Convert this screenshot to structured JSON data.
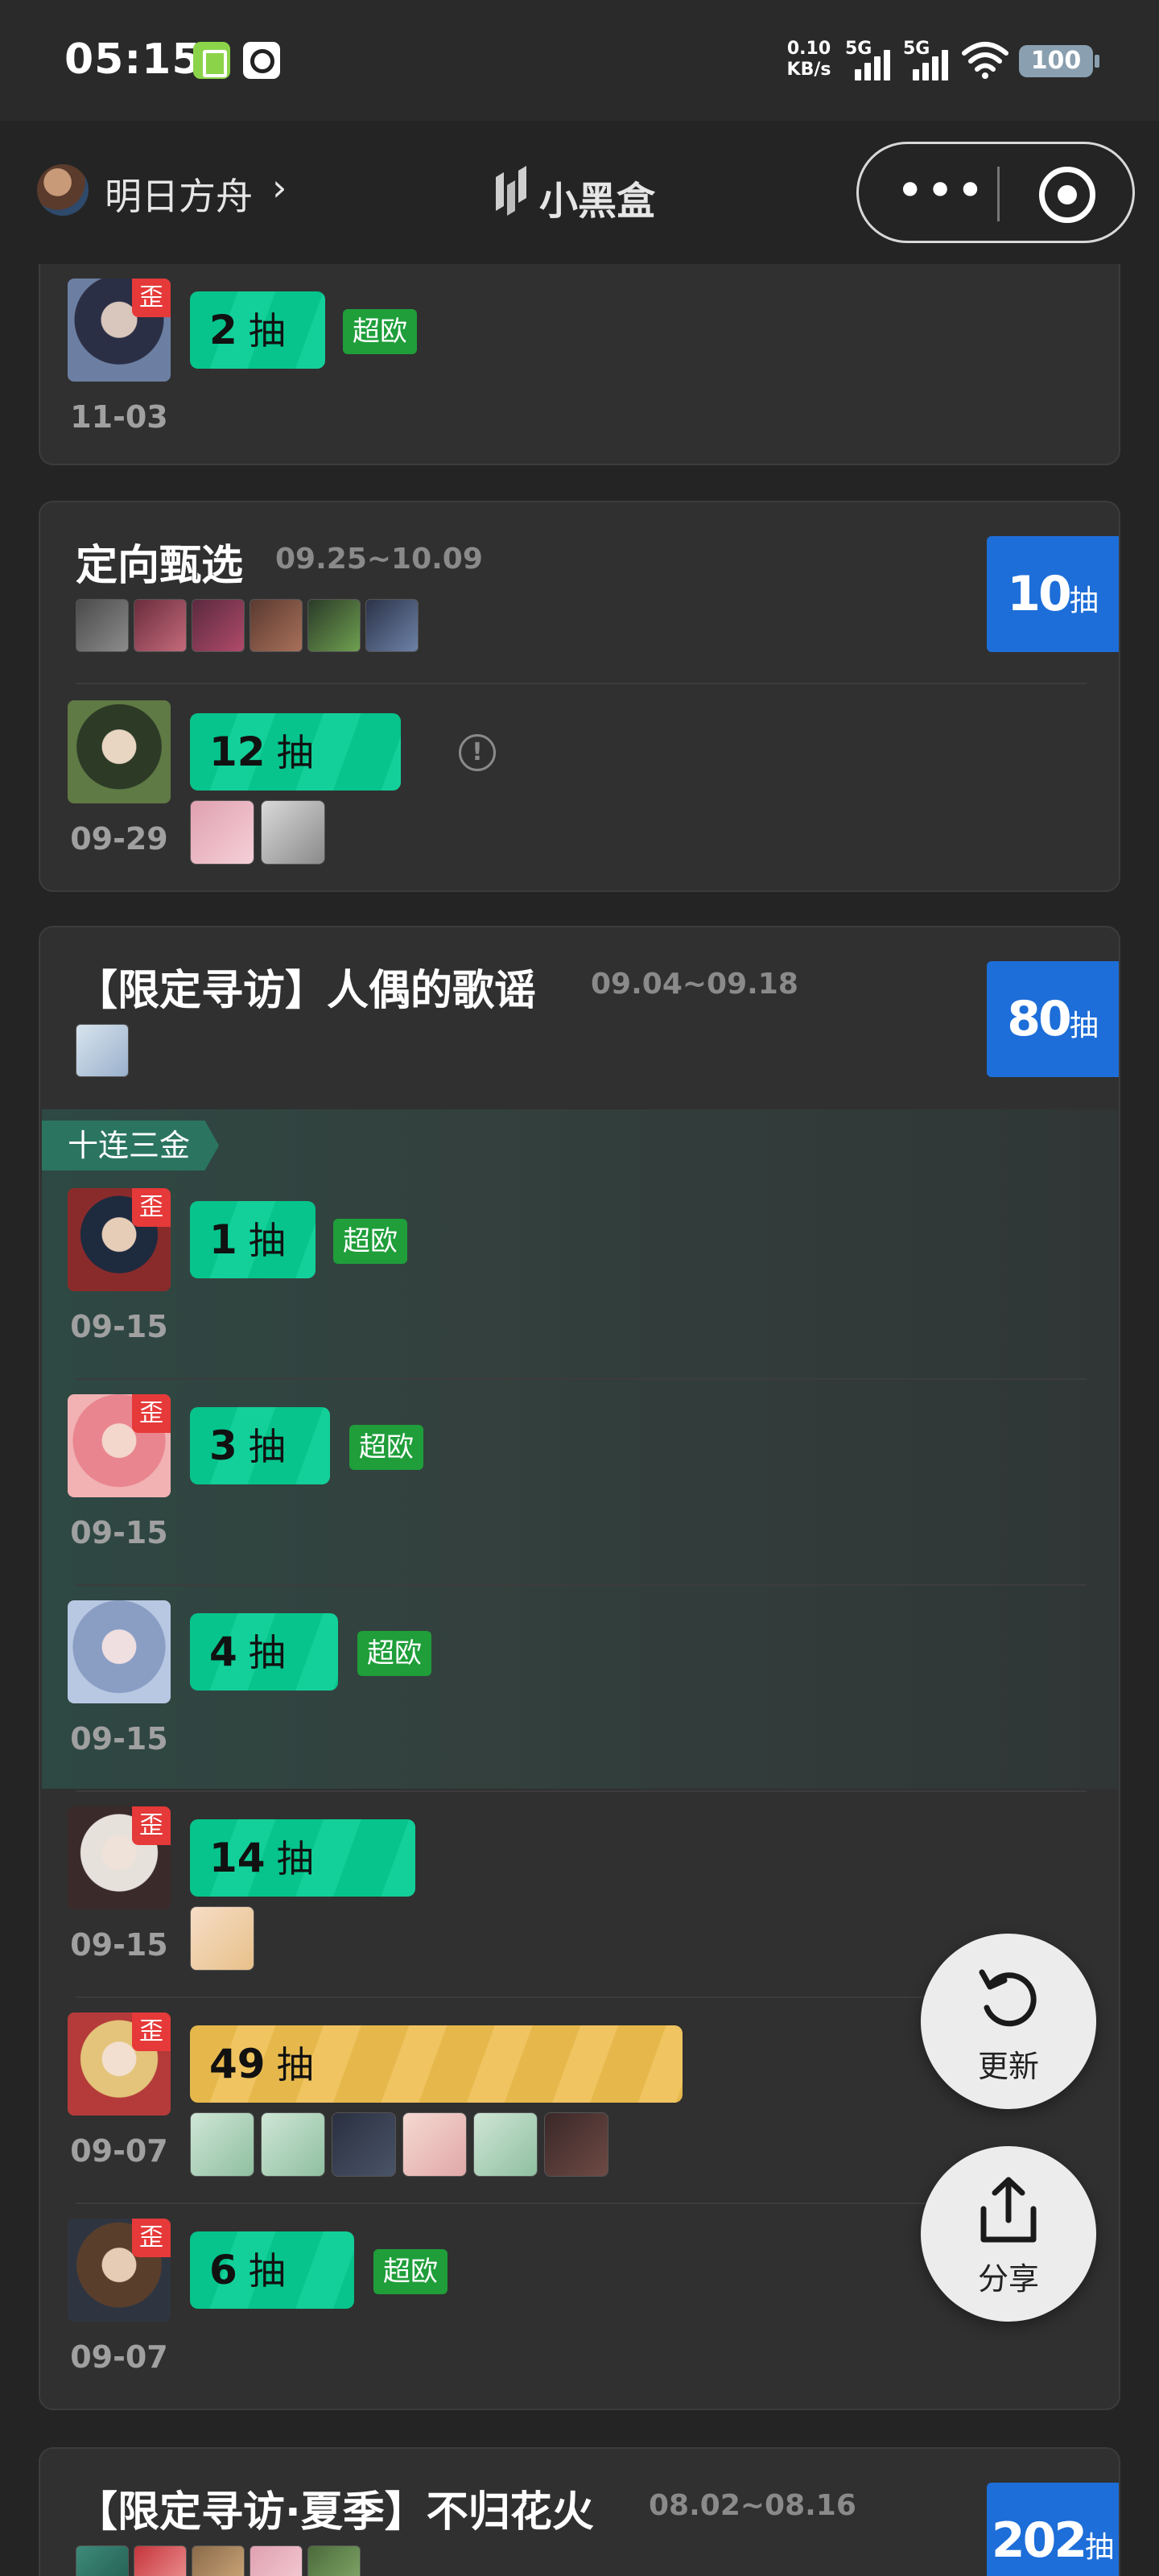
{
  "status_bar": {
    "time": "05:15",
    "net_speed_value": "0.10",
    "net_speed_unit": "KB/s",
    "signal_1": "5G",
    "signal_2": "5G",
    "battery": "100",
    "icons": [
      "checklist-app-icon",
      "search-app-icon",
      "wifi-icon",
      "battery-icon"
    ]
  },
  "nav": {
    "game_title": "明日方舟",
    "brand": "小黑盒",
    "menu_icon": "more-dots-icon",
    "close_icon": "target-close-icon"
  },
  "cards": [
    {
      "partial": true,
      "records": [
        {
          "pulls": "2",
          "unit": "抽",
          "date": "11-03",
          "off_banner": "歪",
          "badge": "超欧",
          "pill": "green"
        }
      ]
    },
    {
      "title": "定向甄选",
      "range": "09.25~10.09",
      "total_num": "10",
      "total_unit": "抽",
      "pool_face_count": 6,
      "records": [
        {
          "pulls": "12",
          "unit": "抽",
          "date": "09-29",
          "info": "!",
          "extra_face_count": 2,
          "pill": "green"
        }
      ]
    },
    {
      "title": "【限定寻访】人偶的歌谣",
      "range": "09.04~09.18",
      "total_num": "80",
      "total_unit": "抽",
      "pool_face_count": 1,
      "ten_pull_label": "十连三金",
      "records": [
        {
          "pulls": "1",
          "unit": "抽",
          "date": "09-15",
          "off_banner": "歪",
          "badge": "超欧",
          "pill": "green"
        },
        {
          "pulls": "3",
          "unit": "抽",
          "date": "09-15",
          "off_banner": "歪",
          "badge": "超欧",
          "pill": "green"
        },
        {
          "pulls": "4",
          "unit": "抽",
          "date": "09-15",
          "badge": "超欧",
          "pill": "green"
        },
        {
          "pulls": "14",
          "unit": "抽",
          "date": "09-15",
          "off_banner": "歪",
          "extra_face_count": 1,
          "pill": "green"
        },
        {
          "pulls": "49",
          "unit": "抽",
          "date": "09-07",
          "off_banner": "歪",
          "extra_face_count": 6,
          "pill": "gold"
        },
        {
          "pulls": "6",
          "unit": "抽",
          "date": "09-07",
          "off_banner": "歪",
          "badge": "超欧",
          "pill": "green"
        }
      ]
    },
    {
      "title": "【限定寻访·夏季】不归花火",
      "range": "08.02~08.16",
      "total_num": "202",
      "total_unit": "抽",
      "pool_face_count": 5
    }
  ],
  "fab": {
    "refresh_label": "更新",
    "share_label": "分享"
  },
  "colors": {
    "background": "#242424",
    "card": "#303030",
    "total_badge": "#1d6ed8",
    "pill_green": "#06c48c",
    "pill_gold": "#e6b84c",
    "badge_green": "#1f9e3a",
    "off_banner_red": "#e63939"
  }
}
